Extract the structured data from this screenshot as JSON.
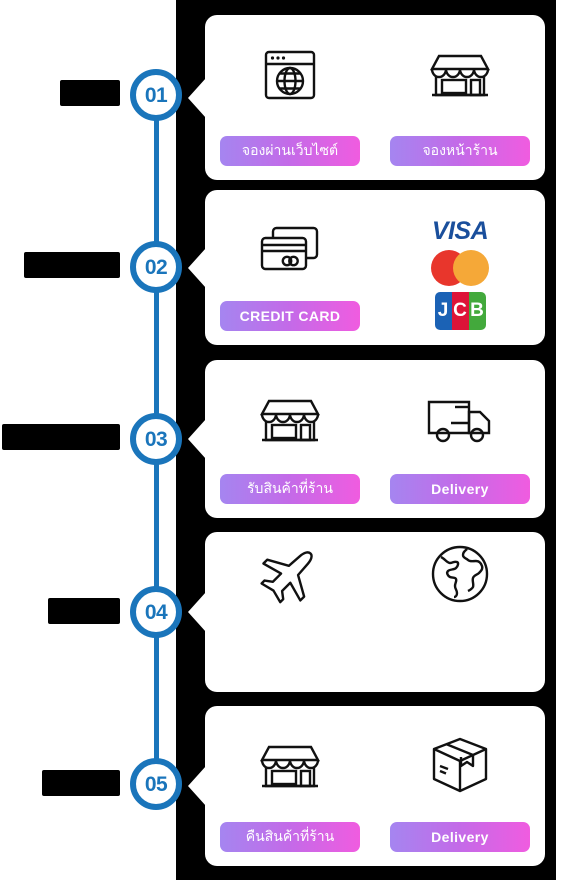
{
  "meta": {
    "title": "Service Process Timeline Infographic",
    "accent_blue": "#1a75bb",
    "panel_black": "#000000",
    "pill_gradient_start": "#a585f0",
    "pill_gradient_end": "#f05ce0"
  },
  "steps": [
    {
      "number": "01",
      "label_redacted": true,
      "label_width": 60,
      "options": [
        {
          "icon": "browser-globe-icon",
          "pill": "จองผ่านเว็บไซต์",
          "pill_script": "thai"
        },
        {
          "icon": "storefront-icon",
          "pill": "จองหน้าร้าน",
          "pill_script": "thai"
        }
      ]
    },
    {
      "number": "02",
      "label_redacted": true,
      "label_width": 96,
      "options": [
        {
          "icon": "credit-cards-icon",
          "pill": "CREDIT CARD",
          "pill_script": "latin"
        },
        {
          "icon": "payment-brands-icon",
          "pill": "",
          "pill_script": "none",
          "brands": [
            "VISA",
            "Mastercard",
            "JCB"
          ],
          "brand_text": {
            "visa": "VISA",
            "jcb_letters": [
              "J",
              "C",
              "B"
            ]
          }
        }
      ]
    },
    {
      "number": "03",
      "label_redacted": true,
      "label_width": 118,
      "options": [
        {
          "icon": "storefront-icon",
          "pill": "รับสินค้าที่ร้าน",
          "pill_script": "thai"
        },
        {
          "icon": "delivery-truck-icon",
          "pill": "Delivery",
          "pill_script": "latin"
        }
      ]
    },
    {
      "number": "04",
      "label_redacted": true,
      "label_width": 72,
      "options": [
        {
          "icon": "airplane-icon",
          "pill": "",
          "pill_script": "none"
        },
        {
          "icon": "globe-icon",
          "pill": "",
          "pill_script": "none"
        }
      ]
    },
    {
      "number": "05",
      "label_redacted": true,
      "label_width": 78,
      "options": [
        {
          "icon": "storefront-icon",
          "pill": "คืนสินค้าที่ร้าน",
          "pill_script": "thai"
        },
        {
          "icon": "package-box-icon",
          "pill": "Delivery",
          "pill_script": "latin"
        }
      ]
    }
  ]
}
